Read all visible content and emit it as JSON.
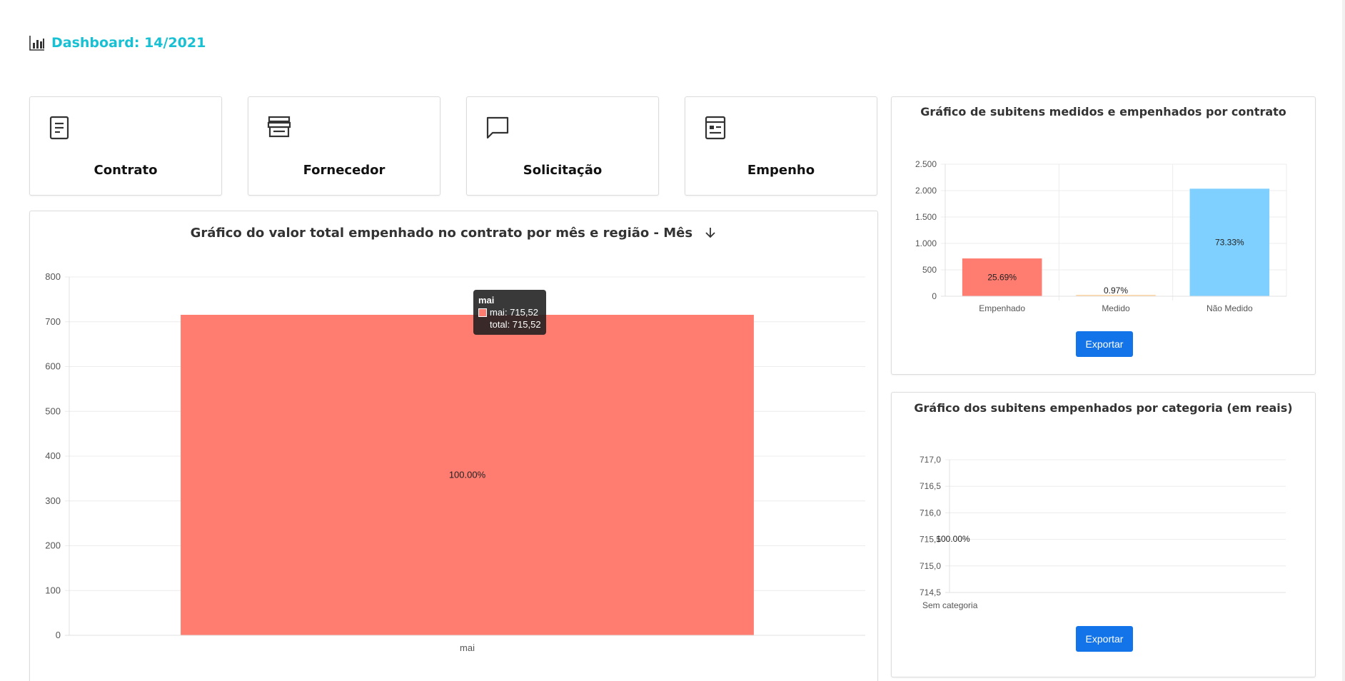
{
  "header": {
    "title": "Dashboard: 14/2021",
    "icon": "bar-chart-icon"
  },
  "tiles": [
    {
      "label": "Contrato",
      "icon": "document-icon"
    },
    {
      "label": "Fornecedor",
      "icon": "store-icon"
    },
    {
      "label": "Solicitação",
      "icon": "message-icon"
    },
    {
      "label": "Empenho",
      "icon": "receipt-icon"
    }
  ],
  "main_chart": {
    "title": "Gráfico do valor total empenhado no contrato por mês e região - Mês",
    "sort_icon": "arrow-down-icon",
    "tooltip": {
      "title": "mai",
      "line1": "mai: 715,52",
      "line2": "total: 715,52"
    }
  },
  "side_chart1": {
    "title": "Gráfico de subitens medidos e empenhados por contrato",
    "export_label": "Exportar"
  },
  "side_chart2": {
    "title": "Gráfico dos subitens empenhados por categoria (em reais)",
    "export_label": "Exportar"
  },
  "colors": {
    "accent": "#17c1d3",
    "bar_red": "#ff7c70",
    "bar_peach": "#ffd8a8",
    "bar_blue": "#80d0ff",
    "button": "#1274e8"
  },
  "chart_data": [
    {
      "type": "bar",
      "categories": [
        "mai"
      ],
      "series": [
        {
          "name": "mai",
          "values": [
            715.52
          ]
        }
      ],
      "data_labels": [
        "100.00%"
      ],
      "yticks": [
        "0",
        "100",
        "200",
        "300",
        "400",
        "500",
        "600",
        "700",
        "800"
      ],
      "ylim": [
        0,
        800
      ],
      "grid": true
    },
    {
      "type": "bar",
      "categories": [
        "Empenhado",
        "Medido",
        "Não Medido"
      ],
      "values": [
        715.52,
        27,
        2036
      ],
      "data_labels": [
        "25.69%",
        "0.97%",
        "73.33%"
      ],
      "yticks": [
        "0",
        "500",
        "1.000",
        "1.500",
        "2.000",
        "2.500"
      ],
      "ylim": [
        0,
        2500
      ],
      "grid": true
    },
    {
      "type": "bar",
      "categories": [
        "Sem categoria"
      ],
      "values": [
        715.52
      ],
      "data_labels": [
        "100.00%"
      ],
      "yticks": [
        "714,5",
        "715,0",
        "715,5",
        "716,0",
        "716,5",
        "717,0"
      ],
      "ylim": [
        714.5,
        717.0
      ],
      "grid": true
    }
  ]
}
